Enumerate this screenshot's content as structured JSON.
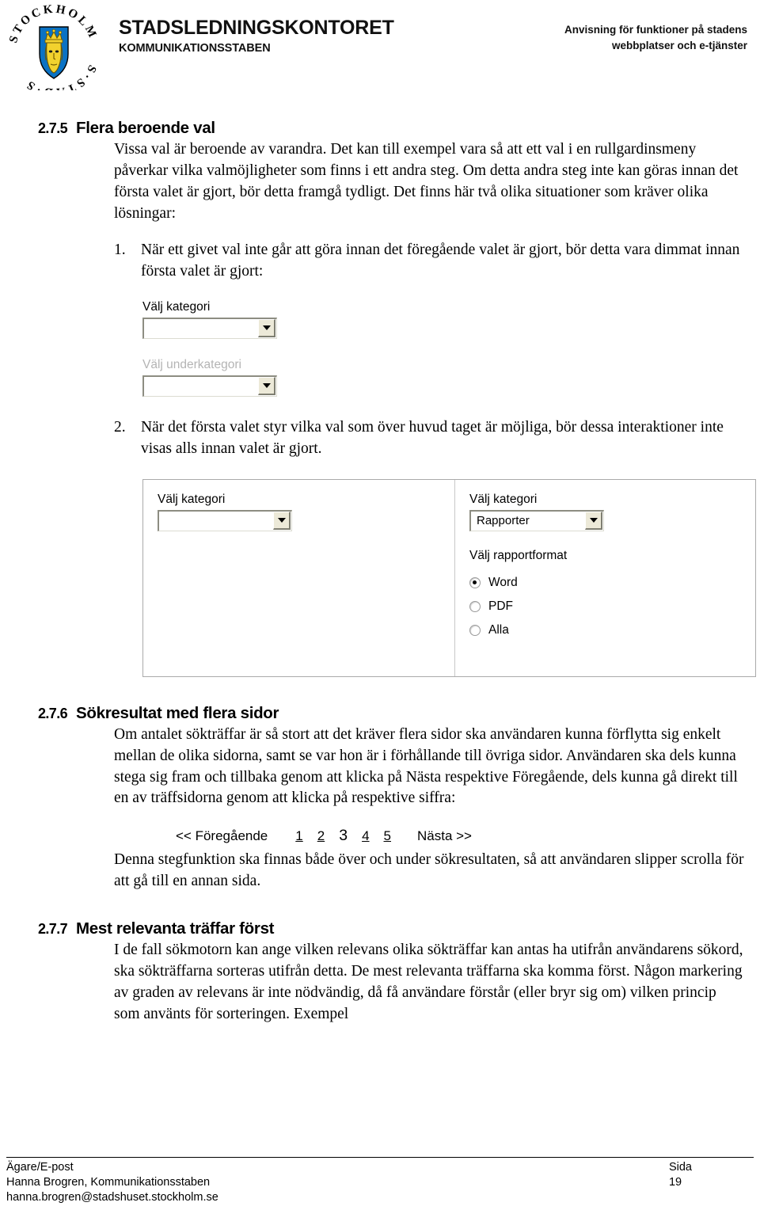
{
  "header": {
    "logo_icon": "stockholm-city-coat-of-arms",
    "logo_ring_text": "STOCKHOLMS STAD",
    "org_name": "STADSLEDNINGSKONTORET",
    "org_sub": "KOMMUNIKATIONSSTABEN",
    "doc_title_line1": "Anvisning för funktioner på stadens",
    "doc_title_line2": "webbplatser och e-tjänster"
  },
  "sections": {
    "s275": {
      "number": "2.7.5",
      "title": "Flera beroende val",
      "intro": "Vissa val är beroende av varandra. Det kan till exempel vara så att ett val i en rullgardinsmeny påverkar vilka valmöjligheter som finns i ett andra steg. Om detta andra steg inte kan göras innan det första valet är gjort, bör detta framgå tydligt. Det finns här två olika situationer som kräver olika lösningar:",
      "item1_marker": "1.",
      "item1_text": "När ett givet val inte går att göra innan det föregående valet är gjort, bör detta vara dimmat innan första valet är gjort:",
      "item2_marker": "2.",
      "item2_text": "När det första valet styr vilka val som över huvud taget är möjliga, bör dessa interaktioner inte visas alls innan valet är gjort."
    },
    "s276": {
      "number": "2.7.6",
      "title": "Sökresultat med flera sidor",
      "body": "Om antalet sökträffar är så stort att det kräver flera sidor ska användaren kunna förflytta sig enkelt mellan de olika sidorna, samt se var hon är i förhållande till övriga sidor. Användaren ska dels kunna stega sig fram och tillbaka genom att klicka på Nästa respektive Föregående, dels kunna gå direkt till en av träffsidorna genom att klicka på respektive siffra:",
      "after": "Denna stegfunktion ska finnas både över och under sökresultaten, så att användaren slipper scrolla för att gå till en annan sida."
    },
    "s277": {
      "number": "2.7.7",
      "title": "Mest relevanta träffar först",
      "body": "I de fall sökmotorn kan ange vilken relevans olika sökträffar kan antas ha utifrån användarens sökord, ska sökträffarna sorteras utifrån detta. De mest relevanta träffarna ska komma först. Någon markering av graden av relevans är inte nödvändig, då få användare förstår (eller bryr sig om) vilken princip som använts för sorteringen. Exempel"
    }
  },
  "mockup1": {
    "label_category": "Välj kategori",
    "value_category": "",
    "label_subcategory": "Välj underkategori",
    "value_subcategory": "",
    "dropdown_icon": "chevron-down-icon"
  },
  "mockup2": {
    "left": {
      "label_category": "Välj kategori",
      "value_category": ""
    },
    "right": {
      "label_category": "Välj kategori",
      "value_category": "Rapporter",
      "label_format": "Välj rapportformat",
      "options": [
        {
          "label": "Word",
          "selected": true
        },
        {
          "label": "PDF",
          "selected": false
        },
        {
          "label": "Alla",
          "selected": false
        }
      ]
    },
    "dropdown_icon": "chevron-down-icon"
  },
  "pagination": {
    "prev_label": "<< Föregående",
    "next_label": "Nästa >>",
    "pages": [
      "1",
      "2",
      "3",
      "4",
      "5"
    ],
    "current_page": "3"
  },
  "footer": {
    "owner_label": "Ägare/E-post",
    "owner_name": "Hanna Brogren, Kommunikationsstaben",
    "owner_email": "hanna.brogren@stadshuset.stockholm.se",
    "page_label": "Sida",
    "page_number": "19"
  },
  "colors": {
    "shield_blue": "#0a72c4",
    "shield_gold": "#f2d22e",
    "combo_button": "#ece9d8",
    "combo_border": "#8d8d82"
  }
}
